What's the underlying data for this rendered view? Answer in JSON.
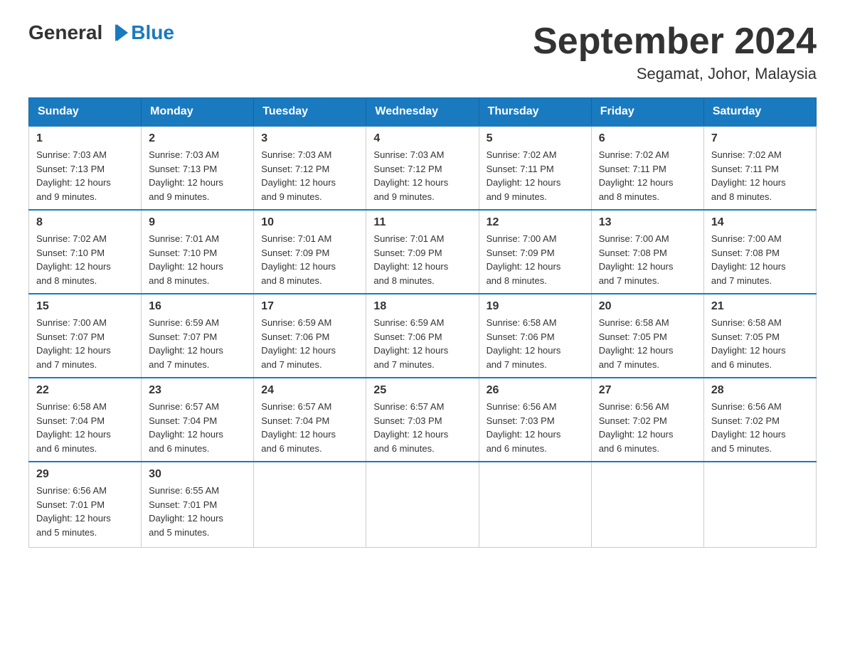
{
  "header": {
    "logo_general": "General",
    "logo_blue": "Blue",
    "month_year": "September 2024",
    "location": "Segamat, Johor, Malaysia"
  },
  "days_of_week": [
    "Sunday",
    "Monday",
    "Tuesday",
    "Wednesday",
    "Thursday",
    "Friday",
    "Saturday"
  ],
  "weeks": [
    [
      {
        "day": "1",
        "sunrise": "7:03 AM",
        "sunset": "7:13 PM",
        "daylight": "12 hours and 9 minutes."
      },
      {
        "day": "2",
        "sunrise": "7:03 AM",
        "sunset": "7:13 PM",
        "daylight": "12 hours and 9 minutes."
      },
      {
        "day": "3",
        "sunrise": "7:03 AM",
        "sunset": "7:12 PM",
        "daylight": "12 hours and 9 minutes."
      },
      {
        "day": "4",
        "sunrise": "7:03 AM",
        "sunset": "7:12 PM",
        "daylight": "12 hours and 9 minutes."
      },
      {
        "day": "5",
        "sunrise": "7:02 AM",
        "sunset": "7:11 PM",
        "daylight": "12 hours and 9 minutes."
      },
      {
        "day": "6",
        "sunrise": "7:02 AM",
        "sunset": "7:11 PM",
        "daylight": "12 hours and 8 minutes."
      },
      {
        "day": "7",
        "sunrise": "7:02 AM",
        "sunset": "7:11 PM",
        "daylight": "12 hours and 8 minutes."
      }
    ],
    [
      {
        "day": "8",
        "sunrise": "7:02 AM",
        "sunset": "7:10 PM",
        "daylight": "12 hours and 8 minutes."
      },
      {
        "day": "9",
        "sunrise": "7:01 AM",
        "sunset": "7:10 PM",
        "daylight": "12 hours and 8 minutes."
      },
      {
        "day": "10",
        "sunrise": "7:01 AM",
        "sunset": "7:09 PM",
        "daylight": "12 hours and 8 minutes."
      },
      {
        "day": "11",
        "sunrise": "7:01 AM",
        "sunset": "7:09 PM",
        "daylight": "12 hours and 8 minutes."
      },
      {
        "day": "12",
        "sunrise": "7:00 AM",
        "sunset": "7:09 PM",
        "daylight": "12 hours and 8 minutes."
      },
      {
        "day": "13",
        "sunrise": "7:00 AM",
        "sunset": "7:08 PM",
        "daylight": "12 hours and 7 minutes."
      },
      {
        "day": "14",
        "sunrise": "7:00 AM",
        "sunset": "7:08 PM",
        "daylight": "12 hours and 7 minutes."
      }
    ],
    [
      {
        "day": "15",
        "sunrise": "7:00 AM",
        "sunset": "7:07 PM",
        "daylight": "12 hours and 7 minutes."
      },
      {
        "day": "16",
        "sunrise": "6:59 AM",
        "sunset": "7:07 PM",
        "daylight": "12 hours and 7 minutes."
      },
      {
        "day": "17",
        "sunrise": "6:59 AM",
        "sunset": "7:06 PM",
        "daylight": "12 hours and 7 minutes."
      },
      {
        "day": "18",
        "sunrise": "6:59 AM",
        "sunset": "7:06 PM",
        "daylight": "12 hours and 7 minutes."
      },
      {
        "day": "19",
        "sunrise": "6:58 AM",
        "sunset": "7:06 PM",
        "daylight": "12 hours and 7 minutes."
      },
      {
        "day": "20",
        "sunrise": "6:58 AM",
        "sunset": "7:05 PM",
        "daylight": "12 hours and 7 minutes."
      },
      {
        "day": "21",
        "sunrise": "6:58 AM",
        "sunset": "7:05 PM",
        "daylight": "12 hours and 6 minutes."
      }
    ],
    [
      {
        "day": "22",
        "sunrise": "6:58 AM",
        "sunset": "7:04 PM",
        "daylight": "12 hours and 6 minutes."
      },
      {
        "day": "23",
        "sunrise": "6:57 AM",
        "sunset": "7:04 PM",
        "daylight": "12 hours and 6 minutes."
      },
      {
        "day": "24",
        "sunrise": "6:57 AM",
        "sunset": "7:04 PM",
        "daylight": "12 hours and 6 minutes."
      },
      {
        "day": "25",
        "sunrise": "6:57 AM",
        "sunset": "7:03 PM",
        "daylight": "12 hours and 6 minutes."
      },
      {
        "day": "26",
        "sunrise": "6:56 AM",
        "sunset": "7:03 PM",
        "daylight": "12 hours and 6 minutes."
      },
      {
        "day": "27",
        "sunrise": "6:56 AM",
        "sunset": "7:02 PM",
        "daylight": "12 hours and 6 minutes."
      },
      {
        "day": "28",
        "sunrise": "6:56 AM",
        "sunset": "7:02 PM",
        "daylight": "12 hours and 5 minutes."
      }
    ],
    [
      {
        "day": "29",
        "sunrise": "6:56 AM",
        "sunset": "7:01 PM",
        "daylight": "12 hours and 5 minutes."
      },
      {
        "day": "30",
        "sunrise": "6:55 AM",
        "sunset": "7:01 PM",
        "daylight": "12 hours and 5 minutes."
      },
      null,
      null,
      null,
      null,
      null
    ]
  ]
}
